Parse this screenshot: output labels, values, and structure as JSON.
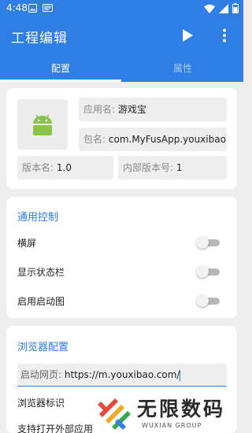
{
  "status_bar": {
    "time": "4:48"
  },
  "app_bar": {
    "title": "工程编辑"
  },
  "tabs": [
    {
      "label": "配置"
    },
    {
      "label": "属性"
    }
  ],
  "app_info": {
    "app_name_label": "应用名:",
    "app_name_value": "游戏宝",
    "package_label": "包名:",
    "package_value": "com.MyFusApp.youxibao",
    "version_name_label": "版本名:",
    "version_name_value": "1.0",
    "version_code_label": "内部版本号:",
    "version_code_value": "1"
  },
  "general": {
    "title": "通用控制",
    "items": [
      {
        "label": "横屏",
        "enabled": false
      },
      {
        "label": "显示状态栏",
        "enabled": false
      },
      {
        "label": "启用启动图",
        "enabled": false
      }
    ]
  },
  "browser": {
    "title": "浏览器配置",
    "url_label": "启动网页:",
    "url_value": "https://m.youxibao.com/",
    "ua_label": "浏览器标识",
    "external_label": "支持打开外部应用"
  },
  "watermark": {
    "name": "无限数码",
    "sub": "WUXIAN GROUP"
  },
  "colors": {
    "accent": "#2f7ee6",
    "android": "#8bc34a",
    "background": "#eeeeee"
  }
}
